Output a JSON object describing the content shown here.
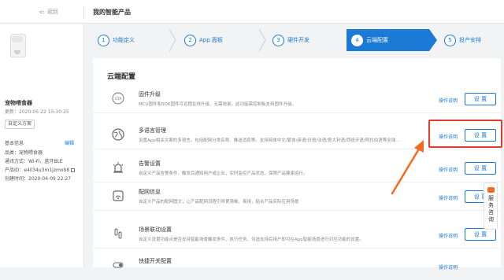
{
  "topbar": {
    "back_label": "返回",
    "title": "我的智能产品"
  },
  "sidebar": {
    "product_name": "宠物喂食器",
    "updated": "更新：2020-05-22 15:30:25",
    "custom_button": "自定义方案",
    "basic_info_label": "基本信息",
    "edit_label": "编辑",
    "info": [
      "品类：宠物喂食器",
      "通讯方式：Wi-Fi、蓝牙BLE",
      "产品ID：e4il34u3m1jzmob8",
      "创建时间：2020-04-09 22:27"
    ]
  },
  "steps": [
    {
      "num": "1",
      "label": "功能定义"
    },
    {
      "num": "2",
      "label": "App 面板"
    },
    {
      "num": "3",
      "label": "硬件开发"
    },
    {
      "num": "4",
      "label": "云端配置"
    },
    {
      "num": "5",
      "label": "投产安排"
    }
  ],
  "active_step": 4,
  "panel": {
    "title": "云端配置",
    "help_label": "操作说明",
    "set_label": "设 置",
    "items": [
      {
        "icon": "ota-icon",
        "name": "固件升级",
        "desc": "MCU固件和SDK固件可远程在线升级、无需烧录。此功能需控制板支持固件升级。"
      },
      {
        "icon": "globe-icon",
        "name": "多语言管理",
        "desc": "设置App相关文案的多语言。包括配网分类名称、推送消息等。支持简体中文/繁体/英语/日语/法语/意大利语/西班牙语/阿拉伯语等全球…"
      },
      {
        "icon": "alarm-icon",
        "name": "告警设置",
        "desc": "自定义产品告警条件、触发后通知用户或企业，实时监控产品状态，保障产品健康运行。"
      },
      {
        "icon": "network-config-icon",
        "name": "配网信息",
        "desc": "自定义产品的配网图文，让产品配网流程引导更清晰、易用，贴合产品实际应用场景"
      },
      {
        "icon": "scene-link-icon",
        "name": "场景联动设置",
        "desc": "自定义设置功能点是否支持智能场景触发条件、执行任务，勾选支持后用户即可在App智能场景进行对应功能的设置。"
      },
      {
        "icon": "switch-icon",
        "name": "快捷开关配置",
        "desc": ""
      }
    ]
  },
  "service_tab": {
    "label": "服务咨询"
  },
  "colors": {
    "accent": "#1a7ad6",
    "highlight": "#e23a2f",
    "service": "#f36b21"
  }
}
